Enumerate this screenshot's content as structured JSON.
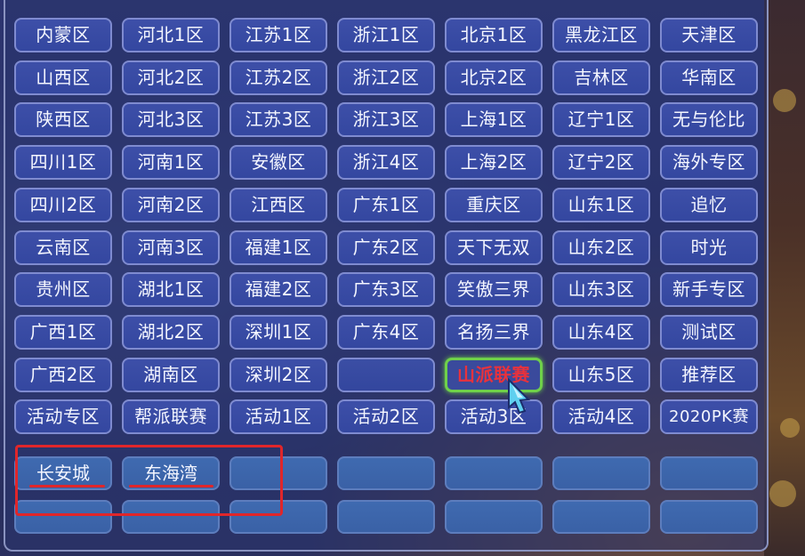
{
  "colors": {
    "button_fill": "#3447a0",
    "button_border": "#7f8bd0",
    "selected_border": "#6fd14a",
    "selected_text": "#e8323c",
    "highlight_red": "#e0262a",
    "lower_button_fill": "#3a61a6"
  },
  "server_grid": [
    [
      "内蒙区",
      "河北1区",
      "江苏1区",
      "浙江1区",
      "北京1区",
      "黑龙江区",
      "天津区"
    ],
    [
      "山西区",
      "河北2区",
      "江苏2区",
      "浙江2区",
      "北京2区",
      "吉林区",
      "华南区"
    ],
    [
      "陕西区",
      "河北3区",
      "江苏3区",
      "浙江3区",
      "上海1区",
      "辽宁1区",
      "无与伦比"
    ],
    [
      "四川1区",
      "河南1区",
      "安徽区",
      "浙江4区",
      "上海2区",
      "辽宁2区",
      "海外专区"
    ],
    [
      "四川2区",
      "河南2区",
      "江西区",
      "广东1区",
      "重庆区",
      "山东1区",
      "追忆"
    ],
    [
      "云南区",
      "河南3区",
      "福建1区",
      "广东2区",
      "天下无双",
      "山东2区",
      "时光"
    ],
    [
      "贵州区",
      "湖北1区",
      "福建2区",
      "广东3区",
      "笑傲三界",
      "山东3区",
      "新手专区"
    ],
    [
      "广西1区",
      "湖北2区",
      "深圳1区",
      "广东4区",
      "名扬三界",
      "山东4区",
      "测试区"
    ],
    [
      "广西2区",
      "湖南区",
      "深圳2区",
      "",
      "山派联赛",
      "山东5区",
      "推荐区"
    ],
    [
      "活动专区",
      "帮派联赛",
      "活动1区",
      "活动2区",
      "活动3区",
      "活动4区",
      "2020PK赛"
    ]
  ],
  "selected_server": "山派联赛",
  "lower_rows": [
    [
      "长安城",
      "东海湾",
      "",
      "",
      "",
      "",
      ""
    ],
    [
      "",
      "",
      "",
      "",
      "",
      "",
      ""
    ]
  ],
  "cursor_icon": "game-pointer-icon"
}
